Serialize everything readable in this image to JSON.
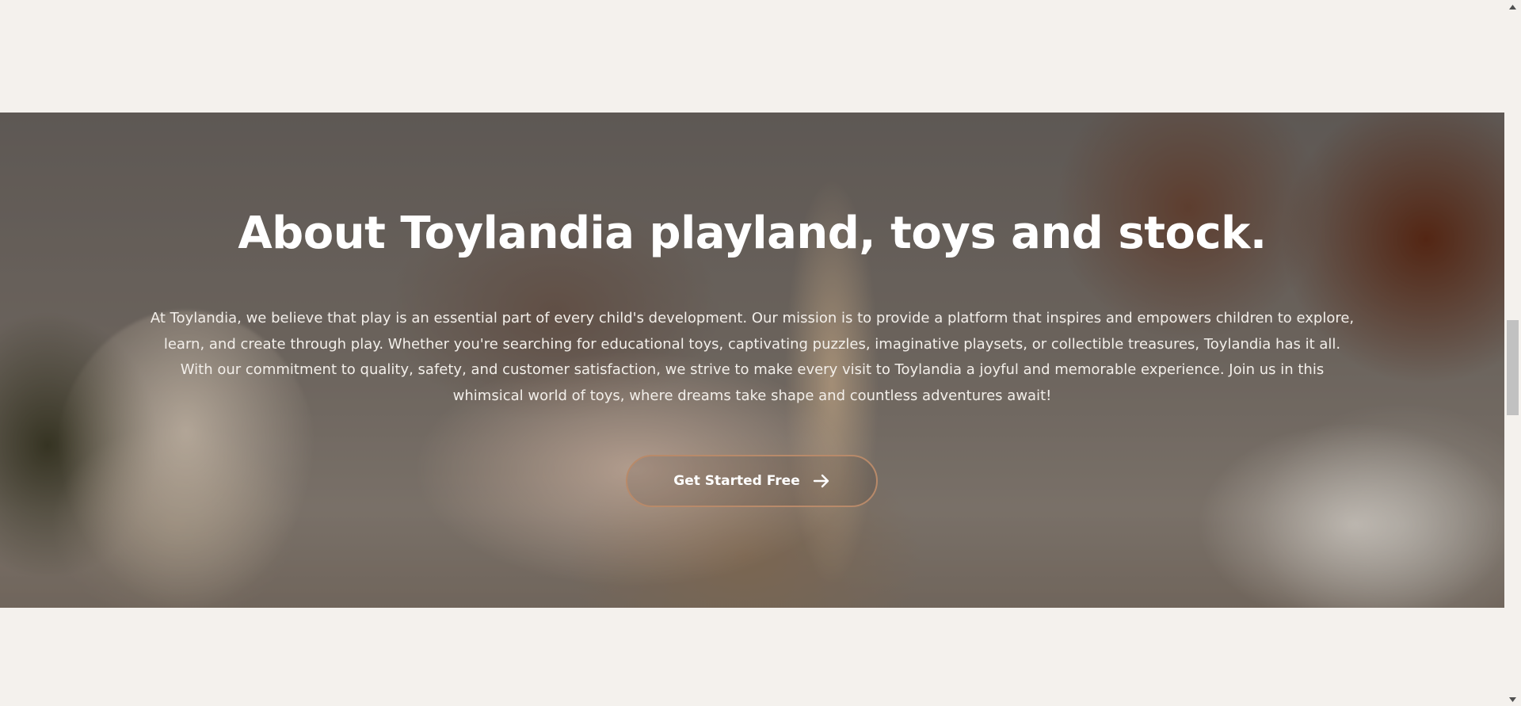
{
  "about": {
    "title": "About Toylandia playland, toys and stock.",
    "description": "At Toylandia, we believe that play is an essential part of every child's development. Our mission is to provide a platform that inspires and empowers children to explore, learn, and create through play. Whether you're searching for educational toys, captivating puzzles, imaginative playsets, or collectible treasures, Toylandia has it all. With our commitment to quality, safety, and customer satisfaction, we strive to make every visit to Toylandia a joyful and memorable experience. Join us in this whimsical world of toys, where dreams take shape and countless adventures await!",
    "cta_label": "Get Started Free",
    "cta_icon": "arrow-right-icon",
    "background_image": "child-playing-with-wooden-toys"
  },
  "scrollbar": {
    "up_icon": "scroll-up-arrow-icon",
    "down_icon": "scroll-down-arrow-icon"
  },
  "colors": {
    "page_background": "#f4f1ed",
    "button_border": "#b88a6a",
    "text": "#ffffff"
  }
}
